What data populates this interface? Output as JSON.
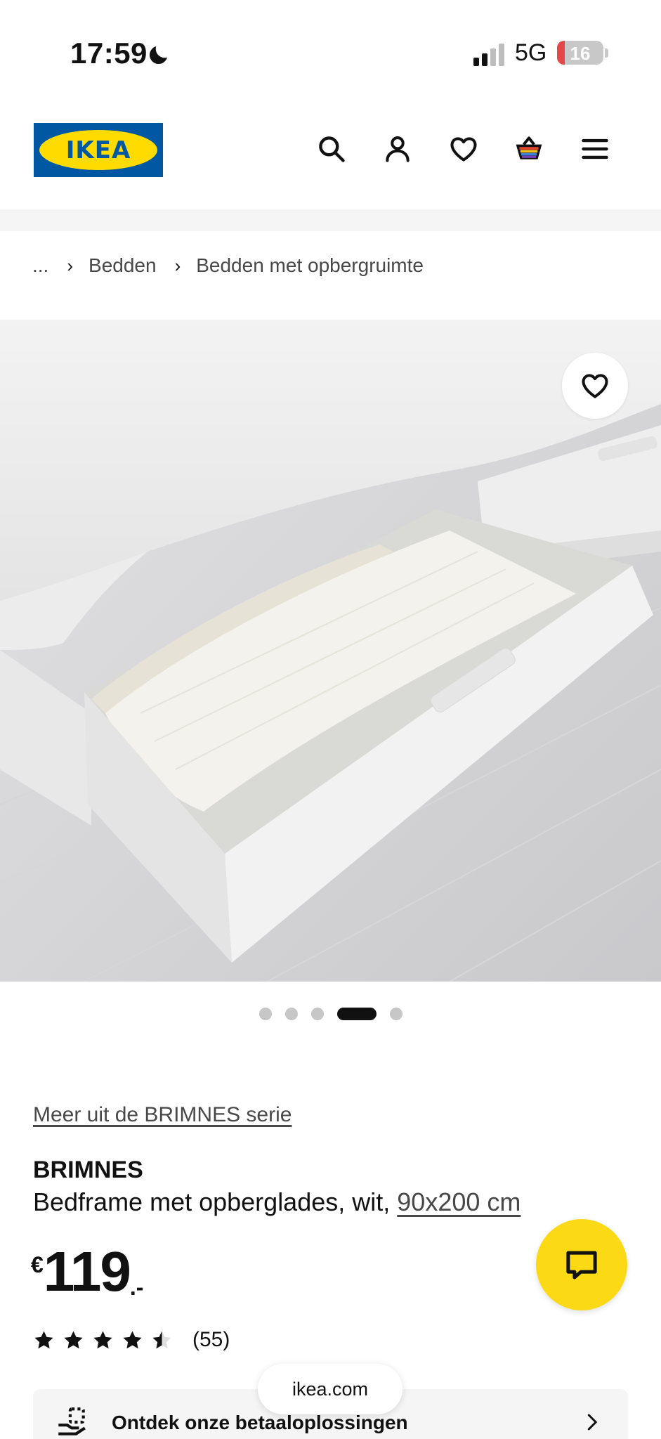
{
  "status_bar": {
    "time": "17:59",
    "network": "5G",
    "battery": "16",
    "battery_level": 0.16
  },
  "header": {
    "logo_text": "IKEA",
    "icons": [
      "search-icon",
      "account-icon",
      "wishlist-icon",
      "cart-icon",
      "menu-icon"
    ],
    "brand_colors": {
      "blue": "#0058a3",
      "yellow": "#ffdb00"
    }
  },
  "breadcrumb": {
    "ellipsis": "...",
    "items": [
      "Bedden",
      "Bedden met opbergruimte"
    ]
  },
  "carousel": {
    "image_count": 5,
    "active_index": 3
  },
  "product": {
    "series_link": "Meer uit de BRIMNES serie",
    "name": "BRIMNES",
    "description": "Bedframe met opberglades, wit,",
    "size": "90x200 cm",
    "price": {
      "currency": "€",
      "integer": "119",
      "decimal": ".-"
    },
    "rating": {
      "value": 4.5,
      "max": 5,
      "count": "(55)"
    }
  },
  "payment_banner": {
    "label": "Ontdek onze betaaloplossingen"
  },
  "browser": {
    "url": "ikea.com"
  },
  "colors": {
    "chat_button": "#fbd914",
    "text": "#111111",
    "muted": "#484848"
  }
}
